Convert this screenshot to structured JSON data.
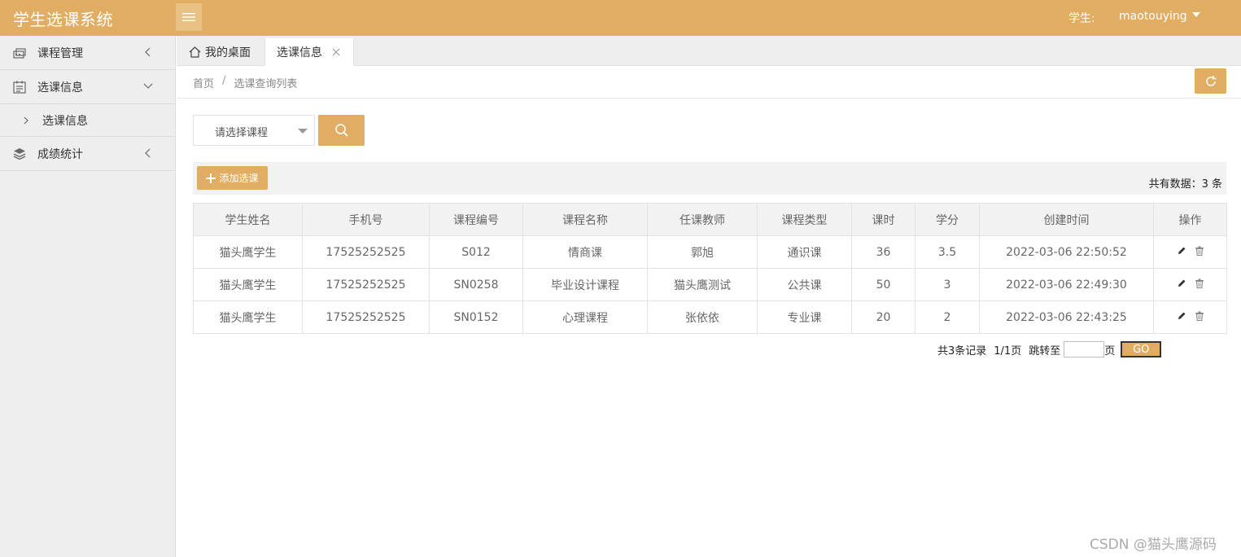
{
  "app": {
    "title": "学生选课系统",
    "user_role_label": "学生:",
    "user_name": "maotouying"
  },
  "sidebar": {
    "items": [
      {
        "label": "课程管理",
        "icon": "course-icon",
        "expanded": false
      },
      {
        "label": "选课信息",
        "icon": "calendar-icon",
        "expanded": true,
        "children": [
          {
            "label": "选课信息"
          }
        ]
      },
      {
        "label": "成绩统计",
        "icon": "layers-icon",
        "expanded": false
      }
    ]
  },
  "tabs": [
    {
      "label": "我的桌面",
      "icon": "home-icon",
      "active": false
    },
    {
      "label": "选课信息",
      "active": true,
      "closable": true
    }
  ],
  "breadcrumb": {
    "home": "首页",
    "separator": "/",
    "current": "选课查询列表"
  },
  "search": {
    "course_select": {
      "selected": "请选择课程"
    }
  },
  "toolbar": {
    "add_label": "添加选课",
    "total_text": "共有数据：3 条"
  },
  "table": {
    "columns": [
      "学生姓名",
      "手机号",
      "课程编号",
      "课程名称",
      "任课教师",
      "课程类型",
      "课时",
      "学分",
      "创建时间",
      "操作"
    ],
    "rows": [
      [
        "猫头鹰学生",
        "17525252525",
        "S012",
        "情商课",
        "郭旭",
        "通识课",
        "36",
        "3.5",
        "2022-03-06 22:50:52"
      ],
      [
        "猫头鹰学生",
        "17525252525",
        "SN0258",
        "毕业设计课程",
        "猫头鹰测试",
        "公共课",
        "50",
        "3",
        "2022-03-06 22:49:30"
      ],
      [
        "猫头鹰学生",
        "17525252525",
        "SN0152",
        "心理课程",
        "张依依",
        "专业课",
        "20",
        "2",
        "2022-03-06 22:43:25"
      ]
    ]
  },
  "pager": {
    "records": "共3条记录",
    "pages": "1/1页",
    "jump_label": "跳转至",
    "page_suffix": "页",
    "page_input_value": "",
    "go_label": "GO"
  },
  "watermark": "CSDN @猫头鹰源码",
  "colors": {
    "accent": "#e0ad63",
    "sidebar_bg": "#eeeeee",
    "border": "#e2e2e2"
  }
}
